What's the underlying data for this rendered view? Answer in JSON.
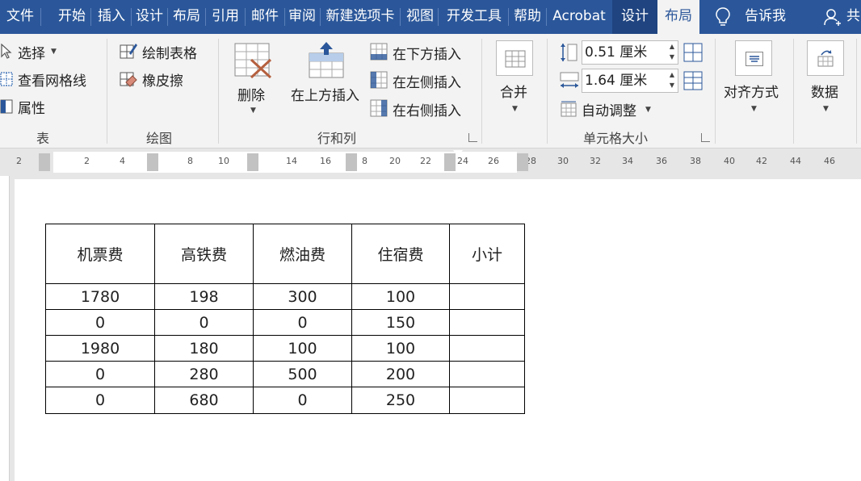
{
  "menubar": {
    "tabs": [
      {
        "label": "文件",
        "name": "menu-tab-file"
      },
      {
        "label": "开始",
        "name": "menu-tab-home"
      },
      {
        "label": "插入",
        "name": "menu-tab-insert"
      },
      {
        "label": "设计",
        "name": "menu-tab-design"
      },
      {
        "label": "布局",
        "name": "menu-tab-page-layout"
      },
      {
        "label": "引用",
        "name": "menu-tab-references"
      },
      {
        "label": "邮件",
        "name": "menu-tab-mailings"
      },
      {
        "label": "审阅",
        "name": "menu-tab-review"
      },
      {
        "label": "新建选项卡",
        "name": "menu-tab-new-tab"
      },
      {
        "label": "视图",
        "name": "menu-tab-view"
      },
      {
        "label": "开发工具",
        "name": "menu-tab-developer"
      },
      {
        "label": "帮助",
        "name": "menu-tab-help"
      },
      {
        "label": "Acrobat",
        "name": "menu-tab-acrobat"
      },
      {
        "label": "设计",
        "name": "menu-tab-table-design"
      },
      {
        "label": "布局",
        "name": "menu-tab-table-layout"
      }
    ],
    "tell_me": "告诉我",
    "share": "共"
  },
  "ribbon": {
    "group_table": {
      "select": "选择",
      "view_gridlines": "查看网格线",
      "properties": "属性",
      "label": "表"
    },
    "group_draw": {
      "draw_table": "绘制表格",
      "eraser": "橡皮擦",
      "label": "绘图"
    },
    "group_rows_cols": {
      "delete": "删除",
      "insert_above": "在上方插入",
      "insert_below": "在下方插入",
      "insert_left": "在左侧插入",
      "insert_right": "在右侧插入",
      "label": "行和列"
    },
    "group_merge": {
      "merge": "合并"
    },
    "group_cell_size": {
      "height_value": "0.51 厘米",
      "width_value": "1.64 厘米",
      "autofit": "自动调整",
      "label": "单元格大小"
    },
    "group_alignment": {
      "alignment": "对齐方式"
    },
    "group_data": {
      "data": "数据"
    }
  },
  "ruler": {
    "numbers": [
      "2",
      "2",
      "4",
      "8",
      "10",
      "14",
      "16",
      "8",
      "20",
      "22",
      "24",
      "26",
      "28",
      "30",
      "32",
      "34",
      "36",
      "38",
      "40",
      "42",
      "44",
      "46"
    ]
  },
  "table": {
    "headers": [
      "机票费",
      "高铁费",
      "燃油费",
      "住宿费",
      "小计"
    ],
    "rows": [
      [
        "1780",
        "198",
        "300",
        "100",
        ""
      ],
      [
        "0",
        "0",
        "0",
        "150",
        ""
      ],
      [
        "1980",
        "180",
        "100",
        "100",
        ""
      ],
      [
        "0",
        "280",
        "500",
        "200",
        ""
      ],
      [
        "0",
        "680",
        "0",
        "250",
        ""
      ]
    ]
  },
  "colors": {
    "menubar_bg": "#2b579a",
    "ribbon_bg": "#f3f3f3",
    "active_tab_text": "#2b579a"
  }
}
